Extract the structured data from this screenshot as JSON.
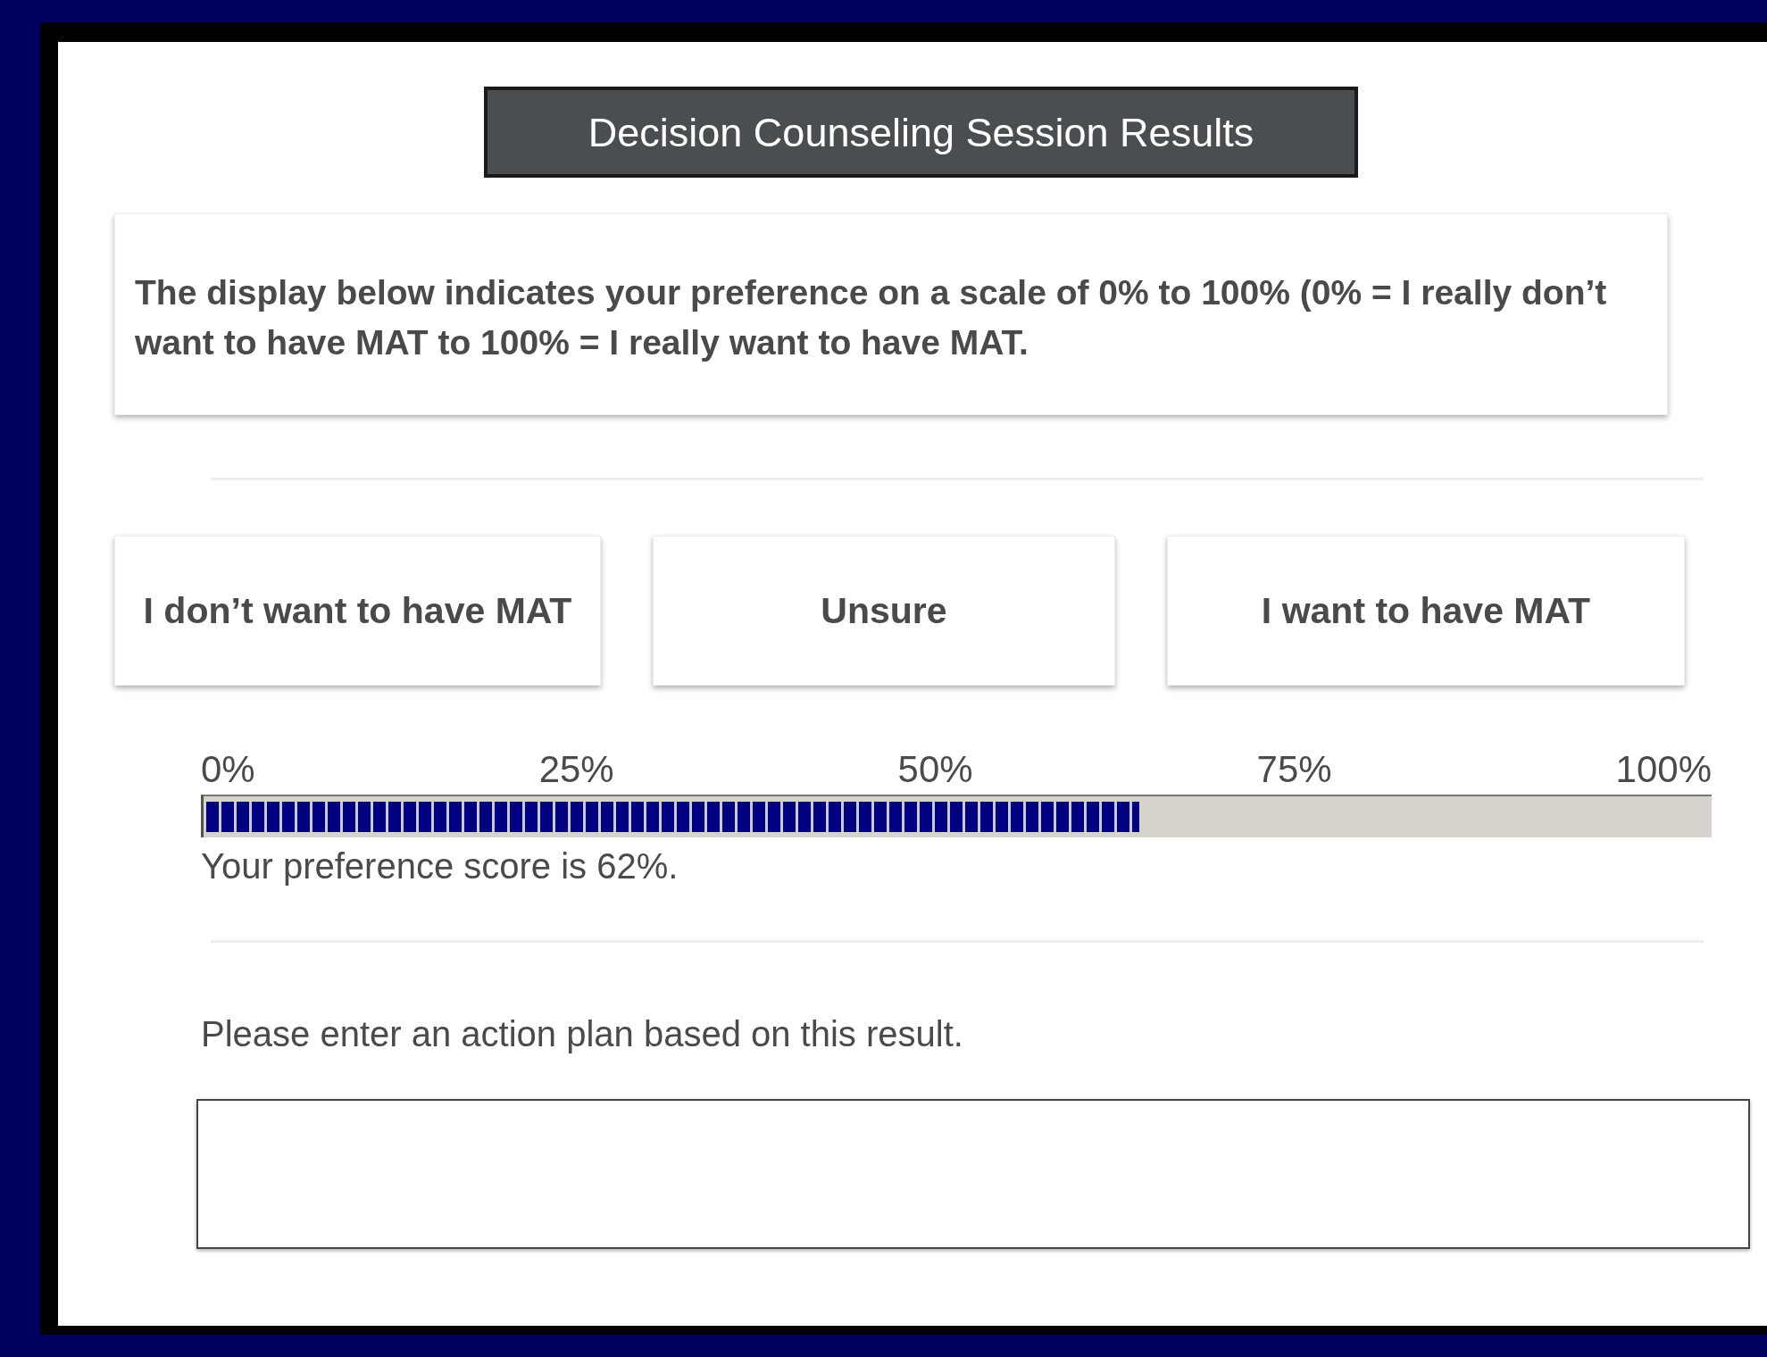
{
  "title": "Decision Counseling Session Results",
  "instruction": "The display below indicates your preference on a scale of 0% to 100% (0% = I really don’t want to have MAT to 100% = I really want to have MAT.",
  "options": [
    {
      "label": "I don’t want to have MAT"
    },
    {
      "label": "Unsure"
    },
    {
      "label": "I want to have MAT"
    }
  ],
  "scale": {
    "ticks": [
      "0%",
      "25%",
      "50%",
      "75%",
      "100%"
    ],
    "level": 0.62,
    "reading": "Your preference score is 62%."
  },
  "action_plan": {
    "prompt": "Please enter an action plan based on this result."
  }
}
